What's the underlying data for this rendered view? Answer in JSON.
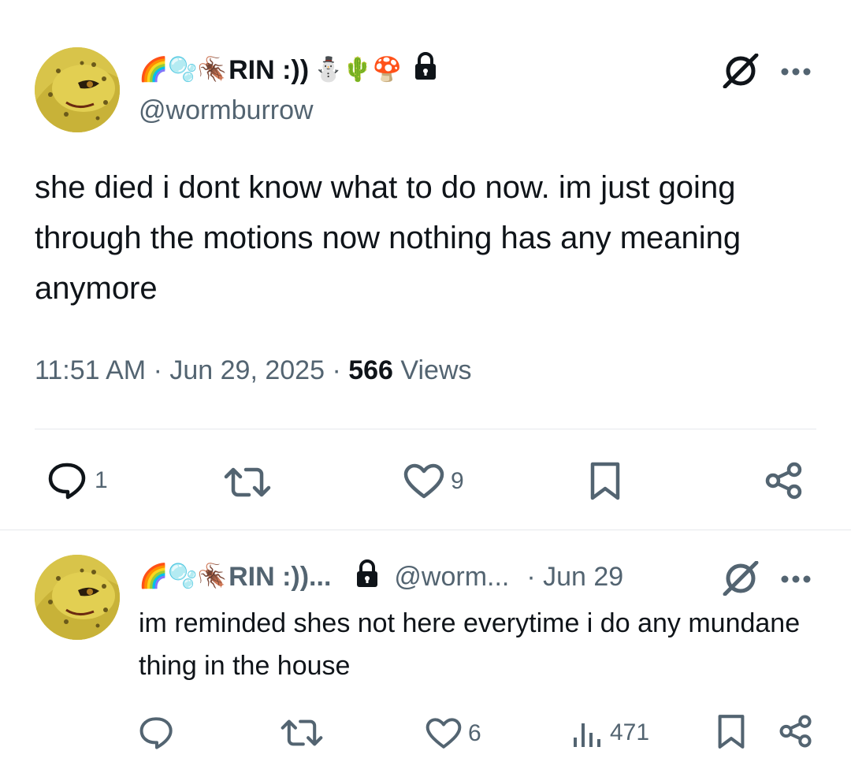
{
  "main_post": {
    "display_name_emoji_before": [
      "🌈",
      "🫧",
      "🪳"
    ],
    "display_name": "RIN :))",
    "display_name_emoji_after": [
      "⛄",
      "🌵",
      "🍄"
    ],
    "locked_icon": "lock-icon",
    "handle": "@wormburrow",
    "text": "she died i dont know what to do now. im just going through the motions now nothing has any meaning anymore",
    "time": "11:51 AM",
    "date": "Jun 29, 2025",
    "views_count": "566",
    "views_label": "Views",
    "actions": {
      "reply_count": "1",
      "repost_count": "",
      "like_count": "9"
    }
  },
  "reply_post": {
    "display_name_emoji_before": [
      "🌈",
      "🫧",
      "🪳"
    ],
    "display_name": "RIN :))...",
    "handle": "@worm...",
    "date": "· Jun 29",
    "text": "im reminded shes not here everytime i do any mundane thing in the house",
    "actions": {
      "reply_count": "",
      "repost_count": "",
      "like_count": "6",
      "views_count": "471"
    }
  },
  "icons": {
    "grok": "grok-icon",
    "more": "more-icon",
    "reply": "reply-icon",
    "repost": "repost-icon",
    "like": "like-icon",
    "bookmark": "bookmark-icon",
    "share": "share-icon",
    "views": "views-icon"
  },
  "colors": {
    "text": "#0f1419",
    "secondary": "#536471",
    "divider": "#e6e9ec"
  }
}
